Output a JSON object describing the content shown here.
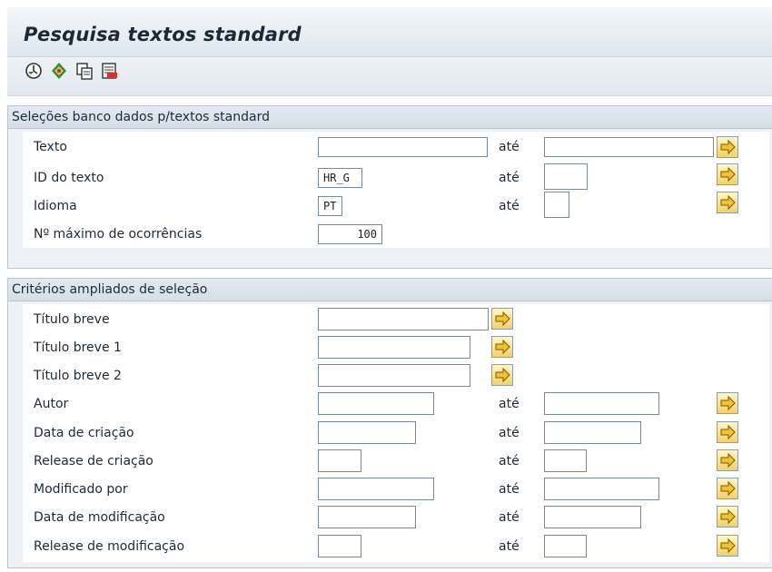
{
  "window": {
    "title": "Pesquisa textos standard"
  },
  "toolbar": {
    "buttons": [
      {
        "icon": "execute-icon"
      },
      {
        "icon": "get-variant-icon"
      },
      {
        "icon": "copy-icon"
      },
      {
        "icon": "variant-attributes-icon"
      }
    ]
  },
  "group1": {
    "title": "Seleções banco dados p/textos standard",
    "rows": [
      {
        "label": "Texto",
        "value": "",
        "to_label": "até",
        "to_value": ""
      },
      {
        "label": "ID do texto",
        "value": "HR_G",
        "to_label": "até",
        "to_value": ""
      },
      {
        "label": "Idioma",
        "value": "PT",
        "to_label": "até",
        "to_value": ""
      },
      {
        "label": "Nº máximo de ocorrências",
        "value": "100"
      }
    ]
  },
  "group2": {
    "title": "Critérios ampliados de seleção",
    "rows": [
      {
        "label": "Título breve",
        "value": ""
      },
      {
        "label": "Título breve 1",
        "value": ""
      },
      {
        "label": "Título breve 2",
        "value": ""
      },
      {
        "label": "Autor",
        "value": "",
        "to_label": "até",
        "to_value": ""
      },
      {
        "label": "Data de criação",
        "value": "",
        "to_label": "até",
        "to_value": ""
      },
      {
        "label": "Release de criação",
        "value": "",
        "to_label": "até",
        "to_value": ""
      },
      {
        "label": "Modificado por",
        "value": "",
        "to_label": "até",
        "to_value": ""
      },
      {
        "label": "Data de modificação",
        "value": "",
        "to_label": "até",
        "to_value": ""
      },
      {
        "label": "Release de modificação",
        "value": "",
        "to_label": "até",
        "to_value": ""
      }
    ]
  },
  "colors": {
    "accent": "#f1d26a",
    "group_bg": "#eef2f6",
    "header_bg": "#dfe6ee",
    "arrow": "#d9a400"
  }
}
